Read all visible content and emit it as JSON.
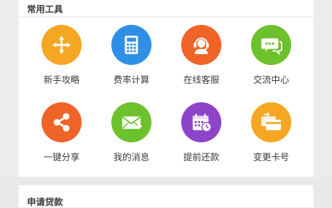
{
  "common_tools": {
    "title": "常用工具",
    "items": [
      {
        "label": "新手攻略",
        "icon": "compass-arrows-icon",
        "color": "#f5a623"
      },
      {
        "label": "费率计算",
        "icon": "calculator-icon",
        "color": "#2f8fe6"
      },
      {
        "label": "在线客服",
        "icon": "headset-agent-icon",
        "color": "#f06428"
      },
      {
        "label": "交流中心",
        "icon": "chat-bubbles-icon",
        "color": "#6cc12c"
      },
      {
        "label": "一键分享",
        "icon": "share-icon",
        "color": "#f06428"
      },
      {
        "label": "我的消息",
        "icon": "envelope-icon",
        "color": "#6cc12c"
      },
      {
        "label": "提前还款",
        "icon": "calendar-clock-icon",
        "color": "#8e44c9"
      },
      {
        "label": "变更卡号",
        "icon": "card-swap-icon",
        "color": "#f5a623"
      }
    ]
  },
  "loan_section": {
    "title": "申请贷款"
  }
}
